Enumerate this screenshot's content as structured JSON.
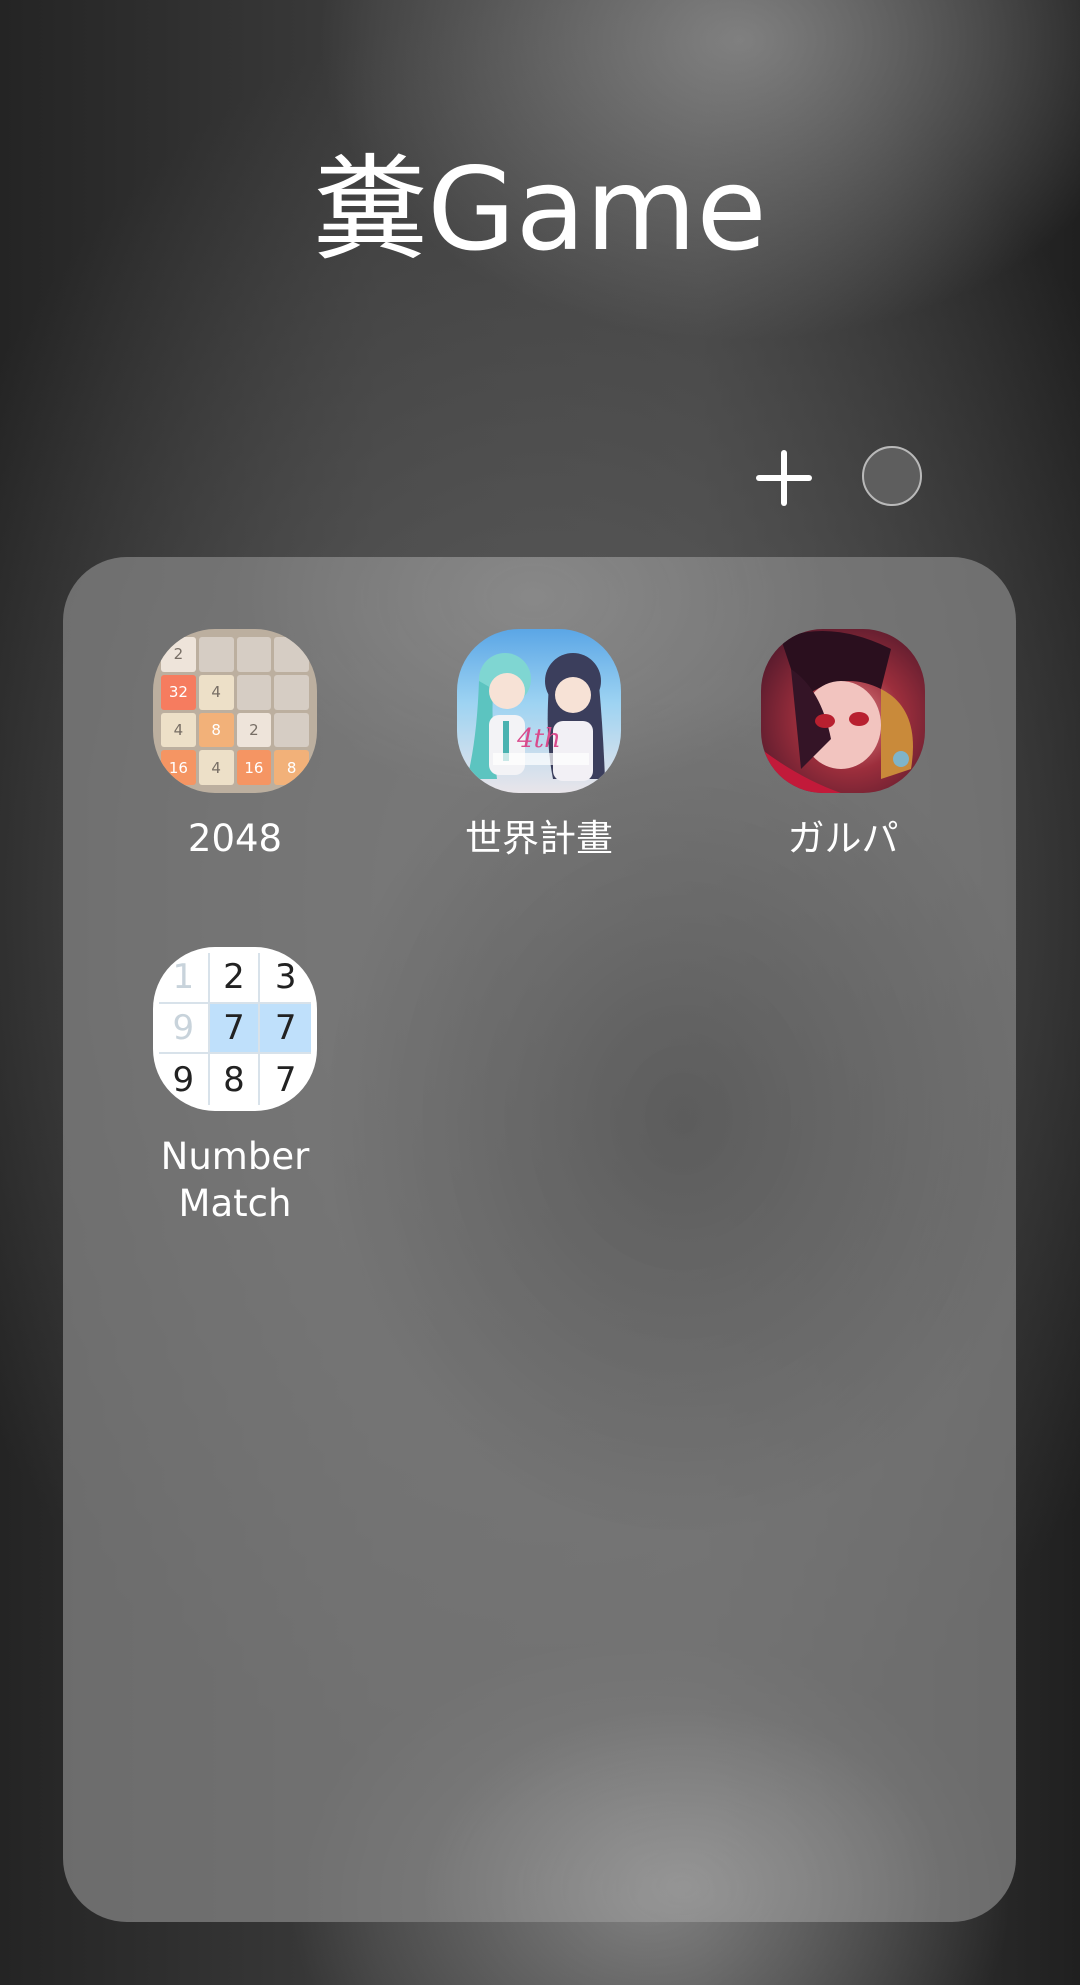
{
  "folder": {
    "title": "糞Game",
    "add_icon": "plus-icon",
    "color_icon": "circle-color-icon"
  },
  "apps": [
    {
      "label": "2048",
      "icon": "2048-tiles-icon",
      "tiles": [
        "2",
        "",
        "",
        "",
        "32",
        "4",
        "",
        "",
        "4",
        "8",
        "2",
        "",
        "16",
        "4",
        "16",
        "8"
      ],
      "tile_colors": [
        "#eee4da",
        "#d6cdc4",
        "#d6cdc4",
        "#d6cdc4",
        "#f67c5f",
        "#ede0c8",
        "#d6cdc4",
        "#d6cdc4",
        "#ede0c8",
        "#f2b179",
        "#eee4da",
        "#d6cdc4",
        "#f59563",
        "#ede0c8",
        "#f59563",
        "#f2b179"
      ]
    },
    {
      "label": "世界計畫",
      "icon": "project-sekai-4th-anniversary-icon"
    },
    {
      "label": "ガルパ",
      "icon": "bang-dream-garupa-icon"
    },
    {
      "label": "Number\nMatch",
      "icon": "number-match-grid-icon",
      "cells": [
        "1",
        "2",
        "3",
        "9",
        "7",
        "7",
        "9",
        "8",
        "7"
      ]
    }
  ]
}
